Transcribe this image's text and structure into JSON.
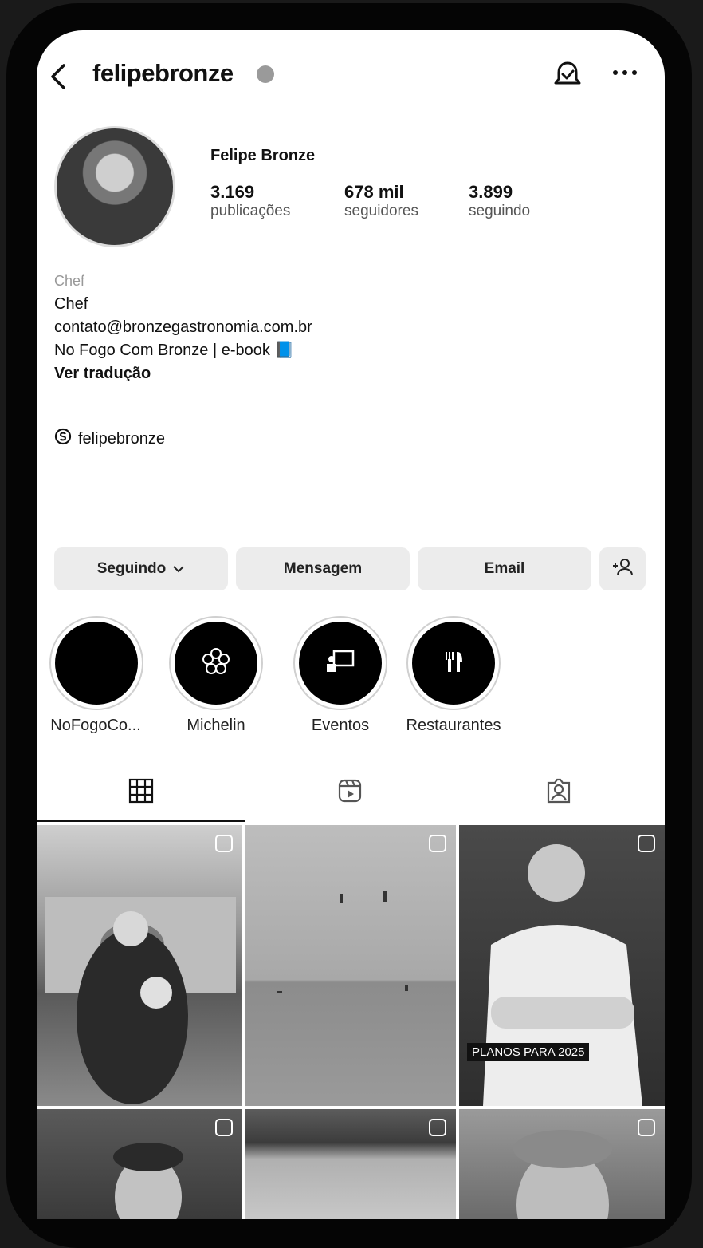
{
  "header": {
    "username": "felipebronze",
    "icons": [
      "back-icon",
      "verified-icon",
      "notification-bell-icon",
      "more-options-icon"
    ]
  },
  "profile": {
    "display_name": "Felipe Bronze",
    "stats": [
      {
        "value": "3.169",
        "label": "publicações"
      },
      {
        "value": "678 mil",
        "label": "seguidores"
      },
      {
        "value": "3.899",
        "label": "seguindo"
      }
    ],
    "category": "Chef",
    "bio_lines": [
      "Chef",
      "contato@bronzegastronomia.com.br",
      "No Fogo Com Bronze | e-book 📘"
    ],
    "translate_link": "Ver tradução",
    "threads_handle": "felipebronze"
  },
  "actions": {
    "following": "Seguindo",
    "message": "Mensagem",
    "email": "Email"
  },
  "highlights": [
    {
      "label": "NoFogoCo...",
      "icon": "blank"
    },
    {
      "label": "Michelin",
      "icon": "flower-icon"
    },
    {
      "label": "Eventos",
      "icon": "presentation-icon"
    },
    {
      "label": "Restaurantes",
      "icon": "cutlery-icon"
    }
  ],
  "tabs": [
    "grid-icon",
    "reels-icon",
    "tagged-icon"
  ],
  "grid": {
    "posts": [
      {
        "kind": "carousel"
      },
      {
        "kind": "reel"
      },
      {
        "kind": "carousel",
        "caption": "PLANOS PARA 2025"
      },
      {
        "kind": "carousel"
      },
      {
        "kind": "reel"
      },
      {
        "kind": "reel"
      }
    ]
  }
}
